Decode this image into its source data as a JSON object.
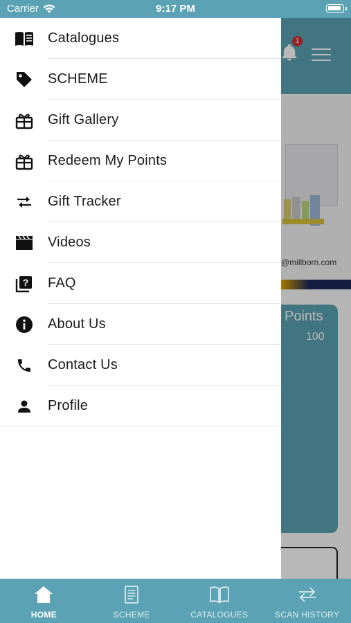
{
  "status_bar": {
    "carrier": "Carrier",
    "time": "9:17 PM"
  },
  "header": {
    "notification_count": "1"
  },
  "banner": {
    "email_text": "@millborn.com"
  },
  "points_card": {
    "label": "Points",
    "value": "100"
  },
  "drawer": {
    "items": [
      {
        "label": "Catalogues",
        "icon": "book-open-icon"
      },
      {
        "label": "SCHEME",
        "icon": "tag-icon"
      },
      {
        "label": "Gift Gallery",
        "icon": "gift-icon"
      },
      {
        "label": "Redeem My Points",
        "icon": "gift-icon"
      },
      {
        "label": "Gift Tracker",
        "icon": "swap-arrows-icon"
      },
      {
        "label": "Videos",
        "icon": "clapperboard-icon"
      },
      {
        "label": "FAQ",
        "icon": "question-box-icon"
      },
      {
        "label": "About Us",
        "icon": "info-icon"
      },
      {
        "label": "Contact Us",
        "icon": "phone-icon"
      },
      {
        "label": "Profile",
        "icon": "person-icon"
      }
    ]
  },
  "tab_bar": {
    "tabs": [
      {
        "label": "HOME",
        "icon": "home-icon",
        "active": true
      },
      {
        "label": "SCHEME",
        "icon": "document-icon",
        "active": false
      },
      {
        "label": "CATALOGUES",
        "icon": "book-icon",
        "active": false
      },
      {
        "label": "SCAN HISTORY",
        "icon": "swap-arrows-icon",
        "active": false
      }
    ]
  },
  "colors": {
    "accent": "#5ba3b4",
    "drawer_bg": "#ffffff",
    "badge": "#d32f2f"
  }
}
